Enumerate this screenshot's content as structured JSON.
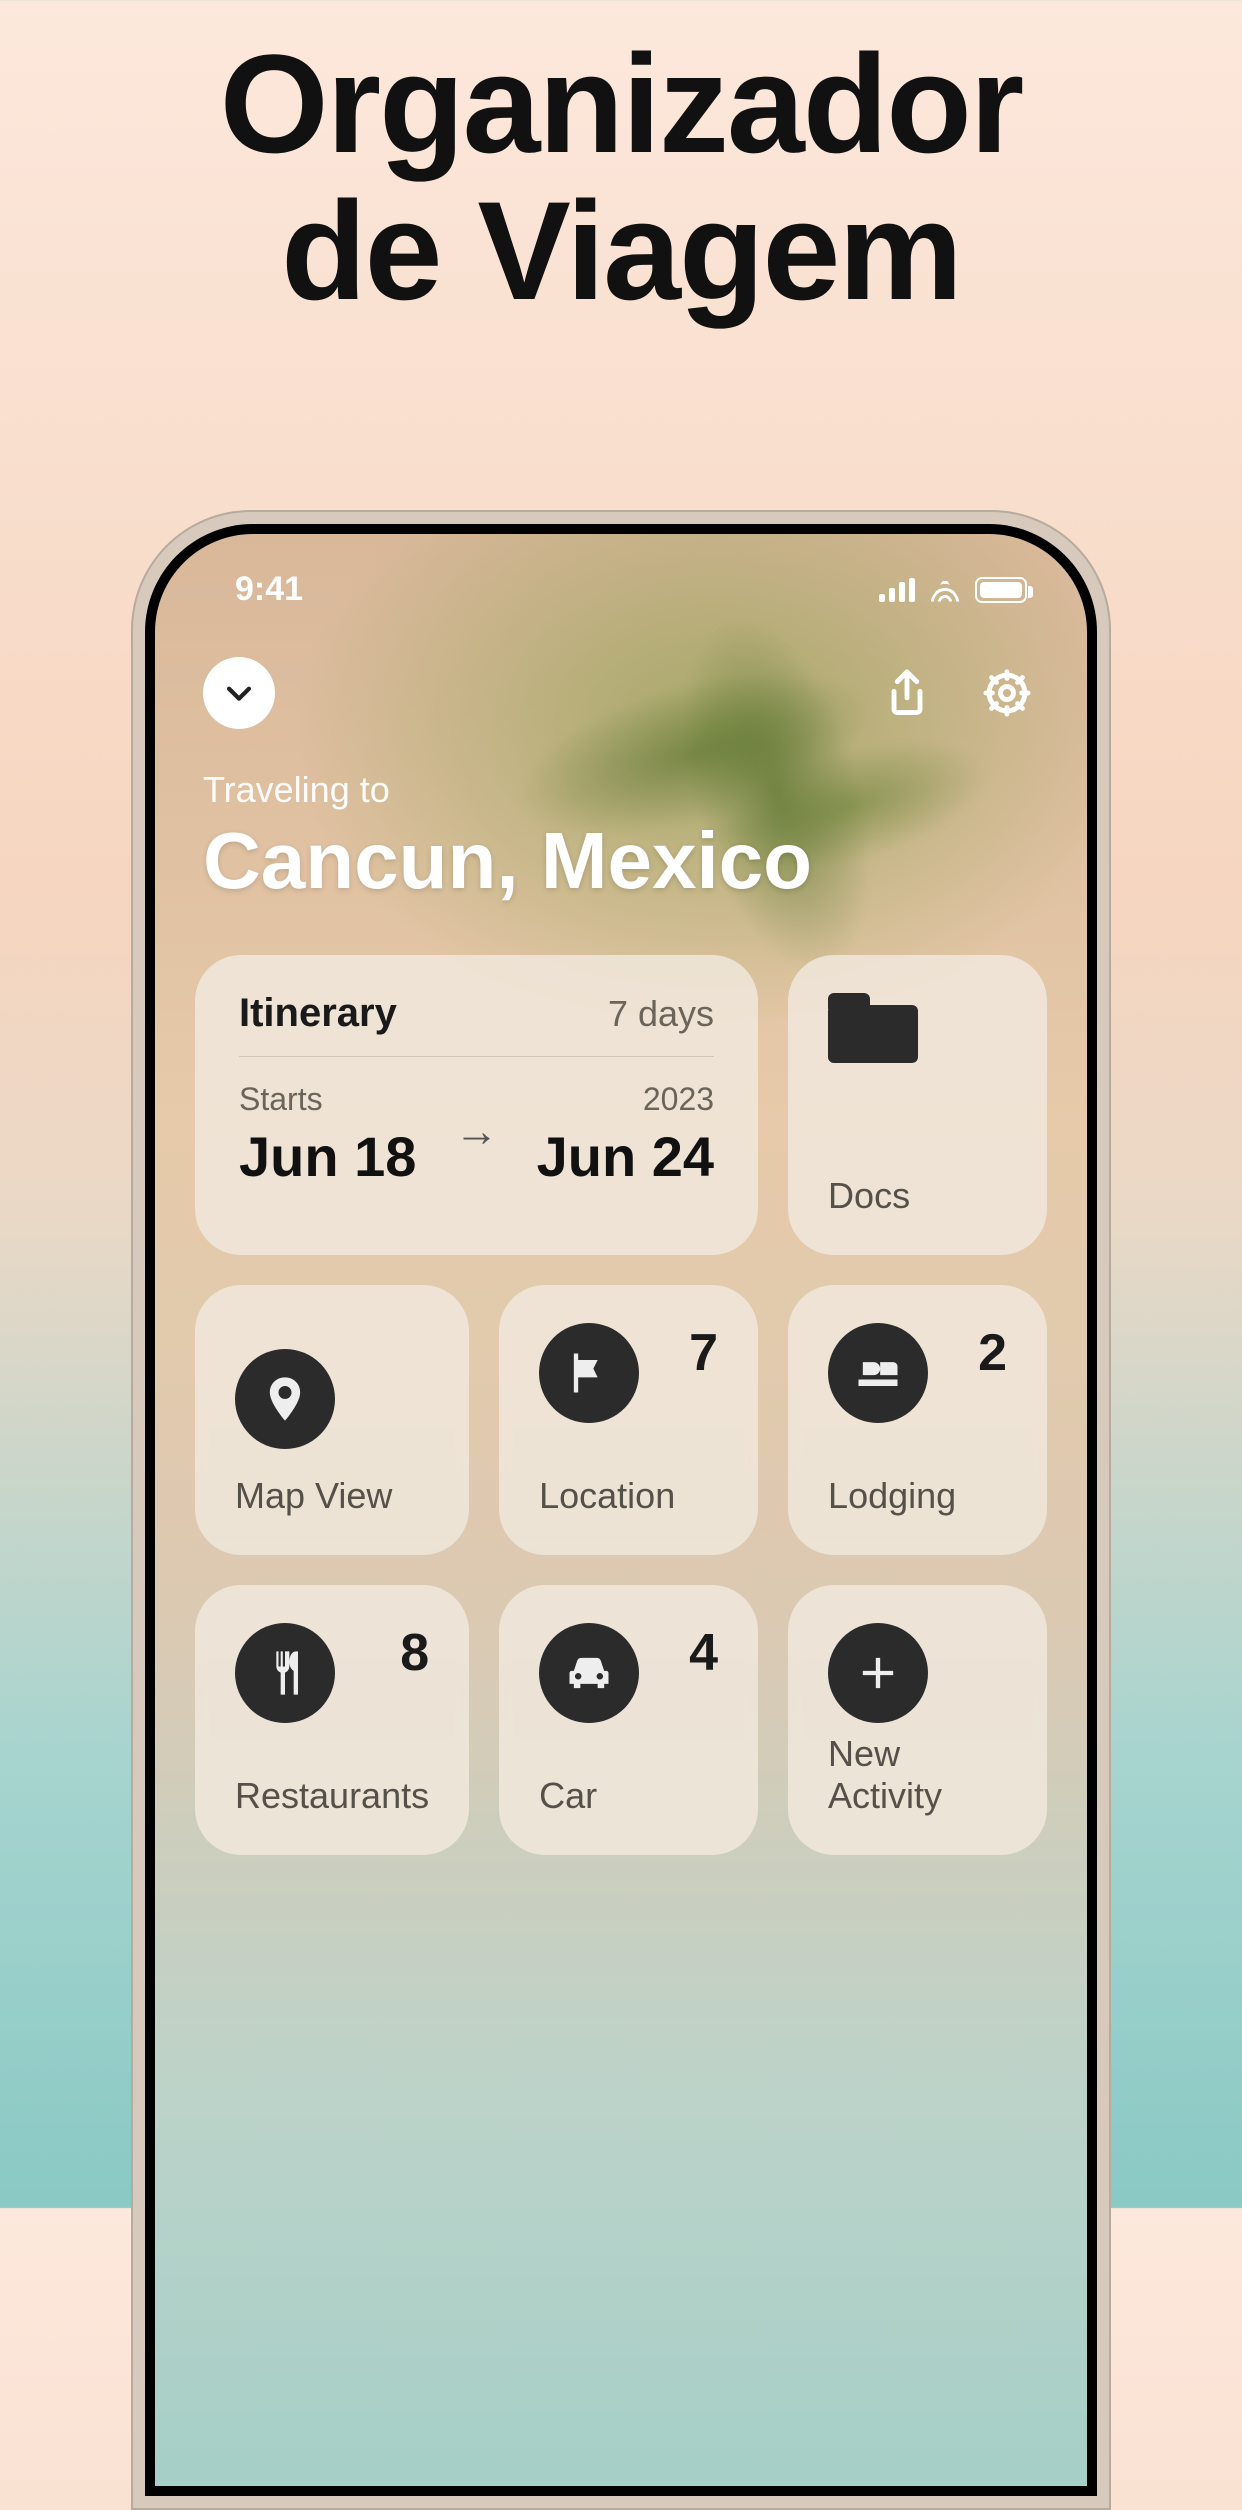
{
  "marketing": {
    "line1": "Organizador",
    "line2": "de Viagem"
  },
  "status": {
    "time": "9:41"
  },
  "header": {
    "traveling_label": "Traveling to",
    "destination": "Cancun, Mexico"
  },
  "itinerary": {
    "title": "Itinerary",
    "duration": "7 days",
    "starts_label": "Starts",
    "year": "2023",
    "start_date": "Jun 18",
    "end_date": "Jun 24"
  },
  "cards": {
    "docs": {
      "label": "Docs"
    },
    "map": {
      "label": "Map View"
    },
    "location": {
      "label": "Location",
      "count": "7"
    },
    "lodging": {
      "label": "Lodging",
      "count": "2"
    },
    "restaurants": {
      "label": "Restaurants",
      "count": "8"
    },
    "car": {
      "label": "Car",
      "count": "4"
    },
    "new_activity": {
      "label": "New Activity"
    }
  }
}
